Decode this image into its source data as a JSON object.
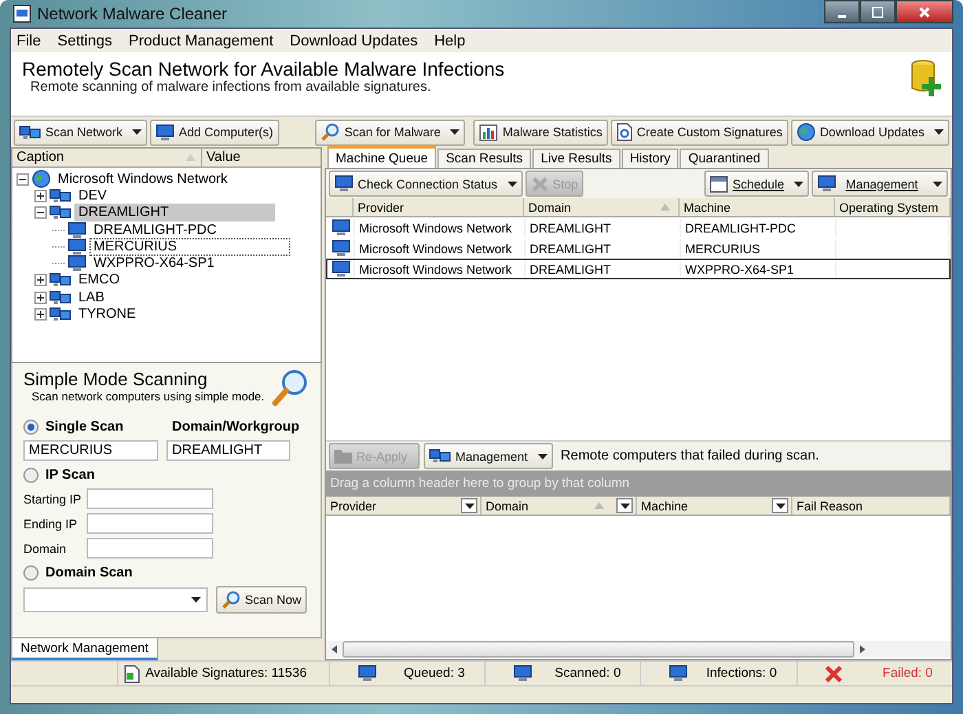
{
  "window": {
    "title": "Network Malware Cleaner"
  },
  "menu": [
    "File",
    "Settings",
    "Product Management",
    "Download Updates",
    "Help"
  ],
  "header": {
    "title": "Remotely Scan Network for Available Malware Infections",
    "subtitle": "Remote scanning of malware infections from available signatures."
  },
  "toolbar_left": [
    {
      "label": "Scan Network",
      "dropdown": true
    },
    {
      "label": "Add Computer(s)",
      "dropdown": false
    }
  ],
  "toolbar_right": [
    {
      "label": "Scan for Malware",
      "dropdown": true
    },
    {
      "label": "Malware Statistics",
      "dropdown": false
    },
    {
      "label": "Create Custom Signatures",
      "dropdown": false
    },
    {
      "label": "Download Updates",
      "dropdown": true
    }
  ],
  "tree": {
    "columns": [
      "Caption",
      "Value"
    ],
    "items": [
      {
        "label": "Microsoft Windows Network",
        "kind": "root",
        "expanded": true,
        "selected": false,
        "children": [
          {
            "label": "DEV",
            "kind": "group",
            "expanded": false,
            "selected": false
          },
          {
            "label": "DREAMLIGHT",
            "kind": "group",
            "expanded": true,
            "selected": true,
            "children": [
              {
                "label": "DREAMLIGHT-PDC",
                "kind": "computer",
                "selected": false,
                "focused": false
              },
              {
                "label": "MERCURIUS",
                "kind": "computer",
                "selected": false,
                "focused": true
              },
              {
                "label": "WXPPRO-X64-SP1",
                "kind": "computer",
                "selected": false,
                "focused": false
              }
            ]
          },
          {
            "label": "EMCO",
            "kind": "group",
            "expanded": false,
            "selected": false
          },
          {
            "label": "LAB",
            "kind": "group",
            "expanded": false,
            "selected": false
          },
          {
            "label": "TYRONE",
            "kind": "group",
            "expanded": false,
            "selected": false
          }
        ]
      }
    ]
  },
  "simple_mode": {
    "title": "Simple Mode Scanning",
    "subtitle": "Scan network computers using simple mode.",
    "single_scan": {
      "label": "Single Scan",
      "selected": true,
      "domain_label": "Domain/Workgroup",
      "computer_value": "MERCURIUS",
      "domain_value": "DREAMLIGHT"
    },
    "ip_scan": {
      "label": "IP Scan",
      "selected": false,
      "fields": [
        "Starting IP",
        "Ending IP",
        "Domain"
      ]
    },
    "domain_scan": {
      "label": "Domain Scan",
      "selected": false
    },
    "scan_button": "Scan Now"
  },
  "left_tabs": [
    {
      "label": "Network Management",
      "selected": true
    }
  ],
  "tabs": [
    {
      "label": "Machine Queue",
      "selected": true
    },
    {
      "label": "Scan Results",
      "selected": false
    },
    {
      "label": "Live Results",
      "selected": false
    },
    {
      "label": "History",
      "selected": false
    },
    {
      "label": "Quarantined",
      "selected": false
    }
  ],
  "queue_toolbar": [
    {
      "label": "Check Connection Status",
      "dropdown": true,
      "disabled": false
    },
    {
      "label": "Stop",
      "disabled": true
    }
  ],
  "queue_toolbar_right": [
    {
      "label": "Schedule",
      "dropdown": true
    },
    {
      "label": "Management",
      "dropdown": true
    }
  ],
  "queue_table": {
    "columns": [
      {
        "label": "Provider",
        "sorted": false
      },
      {
        "label": "Domain",
        "sorted": true
      },
      {
        "label": "Machine",
        "sorted": false
      },
      {
        "label": "Operating System",
        "sorted": false
      }
    ],
    "rows": [
      {
        "provider": "Microsoft Windows Network",
        "domain": "DREAMLIGHT",
        "machine": "DREAMLIGHT-PDC",
        "selected": false
      },
      {
        "provider": "Microsoft Windows Network",
        "domain": "DREAMLIGHT",
        "machine": "MERCURIUS",
        "selected": false
      },
      {
        "provider": "Microsoft Windows Network",
        "domain": "DREAMLIGHT",
        "machine": "WXPPRO-X64-SP1",
        "selected": true
      }
    ]
  },
  "failed_toolbar": {
    "buttons": [
      {
        "label": "Re-Apply",
        "disabled": true
      },
      {
        "label": "Management",
        "dropdown": true,
        "disabled": false
      }
    ],
    "caption": "Remote computers that failed during scan."
  },
  "failed_table": {
    "group_hint": "Drag a column header here to group by that column",
    "columns": [
      {
        "label": "Provider",
        "sorted": false
      },
      {
        "label": "Domain",
        "sorted": true
      },
      {
        "label": "Machine",
        "sorted": false
      },
      {
        "label": "Fail Reason",
        "sorted": false
      }
    ]
  },
  "status_bar": {
    "signatures": "Available Signatures: 11536",
    "counters": [
      {
        "label": "Queued:",
        "value": "3",
        "kind": "normal"
      },
      {
        "label": "Scanned:",
        "value": "0",
        "kind": "normal"
      },
      {
        "label": "Infections:",
        "value": "0",
        "kind": "normal"
      },
      {
        "label": "Failed:",
        "value": "0",
        "kind": "error"
      }
    ]
  }
}
